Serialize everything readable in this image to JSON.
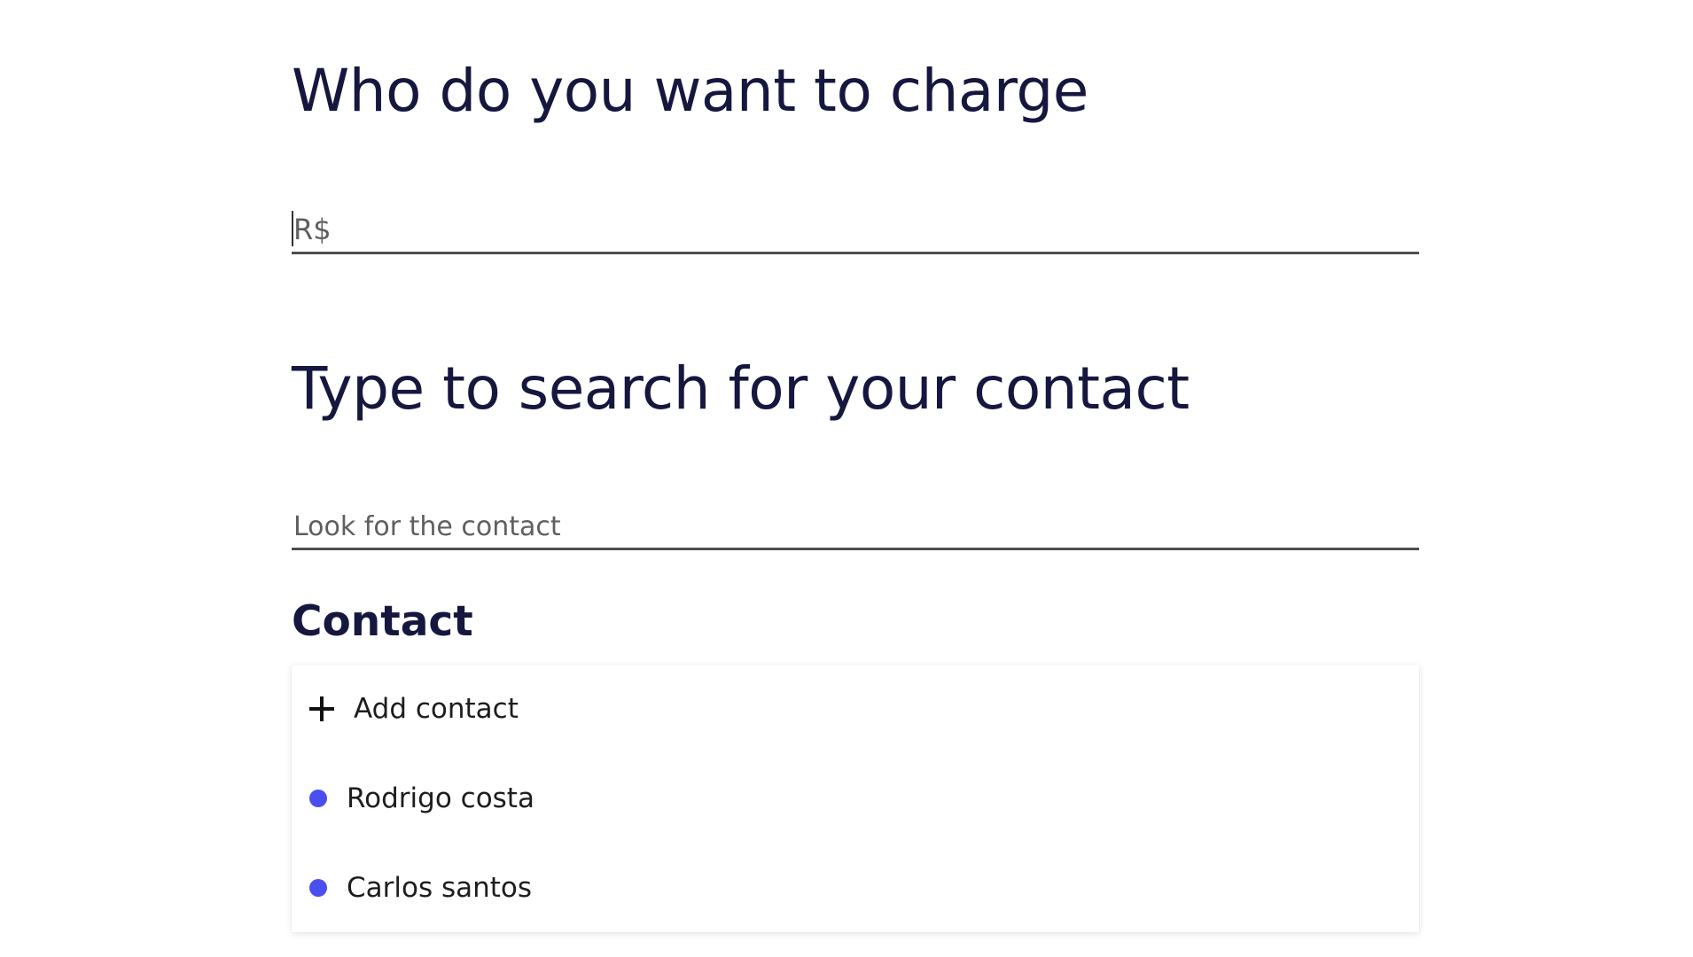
{
  "charge": {
    "heading": "Who do you want to charge",
    "amount_placeholder": "R$",
    "amount_value": ""
  },
  "search": {
    "heading": "Type to search for your contact",
    "placeholder": "Look for the contact",
    "value": ""
  },
  "contacts": {
    "title": "Contact",
    "add_label": "Add contact",
    "add_icon": "plus-icon",
    "dot_color": "#4b4ff0",
    "items": [
      {
        "name": "Rodrigo costa"
      },
      {
        "name": "Carlos santos"
      }
    ]
  },
  "colors": {
    "heading": "#16173f",
    "text": "#1d1d1d",
    "underline": "#4e4e4e",
    "accent": "#4b4ff0"
  }
}
